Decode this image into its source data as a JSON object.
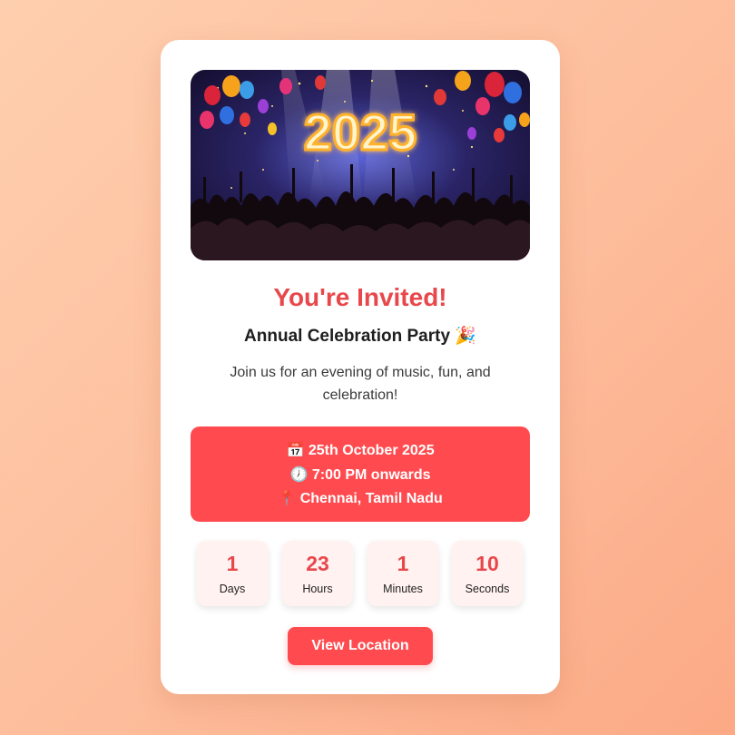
{
  "hero": {
    "banner_text": "2025"
  },
  "invite": {
    "title": "You're Invited!",
    "subtitle": "Annual Celebration Party 🎉",
    "description": "Join us for an evening of music, fun, and celebration!"
  },
  "details": [
    {
      "icon": "calendar-icon",
      "glyph": "📅",
      "text": "25th October 2025"
    },
    {
      "icon": "clock-icon",
      "glyph": "🕖",
      "text": "7:00 PM onwards"
    },
    {
      "icon": "pin-icon",
      "glyph": "📍",
      "text": "Chennai, Tamil Nadu"
    }
  ],
  "countdown": [
    {
      "value": "1",
      "label": "Days"
    },
    {
      "value": "23",
      "label": "Hours"
    },
    {
      "value": "1",
      "label": "Minutes"
    },
    {
      "value": "10",
      "label": "Seconds"
    }
  ],
  "button": {
    "label": "View Location"
  },
  "colors": {
    "accent": "#ff4b4f",
    "title": "#e8474b",
    "tile_bg": "#fff2f0"
  }
}
